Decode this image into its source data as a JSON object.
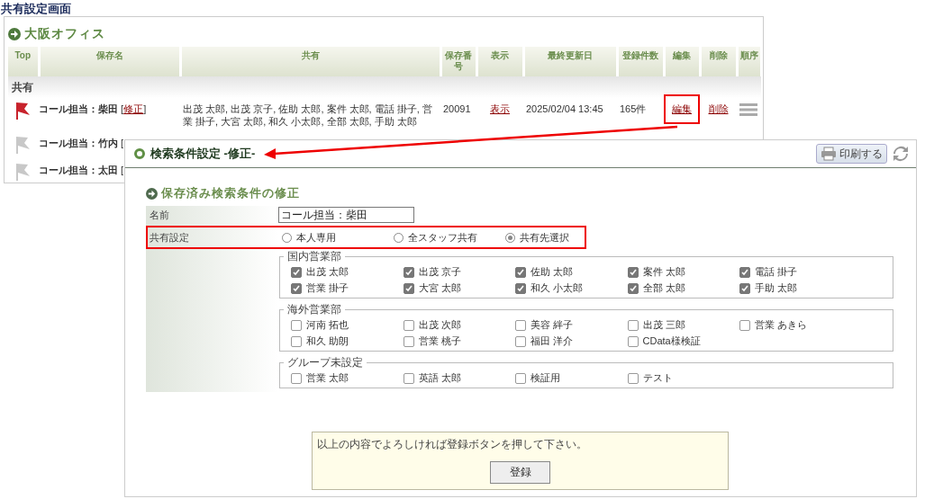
{
  "page_title": "共有設定画面",
  "office_panel": {
    "title": "大阪オフィス",
    "columns": [
      "Top",
      "保存名",
      "共有",
      "保存番号",
      "表示",
      "最終更新日",
      "登録件数",
      "編集",
      "削除",
      "順序"
    ],
    "group": "共有",
    "rows": [
      {
        "flag_active": true,
        "name": "コール担当：柴田",
        "bracket_open": "[",
        "edit_link": "修正",
        "bracket_close": "]",
        "shared_with": "出茂 太郎, 出茂 京子, 佐助 太郎, 案件 太郎, 電話 掛子, 営業 掛子, 大宮 太郎, 和久 小太郎, 全部 太郎, 手助 太郎",
        "number": "20091",
        "view_link": "表示",
        "updated": "2025/02/04 13:45",
        "count": "165件",
        "edit": "編集",
        "edit_highlighted": true,
        "delete": "削除"
      },
      {
        "flag_active": false,
        "name": "コール担当：竹内",
        "bracket_open": "["
      },
      {
        "flag_active": false,
        "name": "コール担当：太田",
        "bracket_open": "["
      }
    ]
  },
  "dialog": {
    "title": "検索条件設定 -修正-",
    "print_button": "印刷する",
    "section_title": "保存済み検索条件の修正",
    "name_label": "名前",
    "name_value": "コール担当：柴田",
    "share_label": "共有設定",
    "share_highlighted": true,
    "share_options": [
      {
        "label": "本人専用",
        "selected": false
      },
      {
        "label": "全スタッフ共有",
        "selected": false
      },
      {
        "label": "共有先選択",
        "selected": true
      }
    ],
    "groups": [
      {
        "title": "国内営業部",
        "members": [
          {
            "name": "出茂 太郎",
            "checked": true
          },
          {
            "name": "出茂 京子",
            "checked": true
          },
          {
            "name": "佐助 太郎",
            "checked": true
          },
          {
            "name": "案件 太郎",
            "checked": true
          },
          {
            "name": "電話 掛子",
            "checked": true
          },
          {
            "name": "営業 掛子",
            "checked": true
          },
          {
            "name": "大宮 太郎",
            "checked": true
          },
          {
            "name": "和久 小太郎",
            "checked": true
          },
          {
            "name": "全部 太郎",
            "checked": true
          },
          {
            "name": "手助 太郎",
            "checked": true
          }
        ]
      },
      {
        "title": "海外営業部",
        "members": [
          {
            "name": "河南 拓也",
            "checked": false
          },
          {
            "name": "出茂 次郎",
            "checked": false
          },
          {
            "name": "美容 絆子",
            "checked": false
          },
          {
            "name": "出茂 三郎",
            "checked": false
          },
          {
            "name": "営業 あきら",
            "checked": false
          },
          {
            "name": "和久 助朗",
            "checked": false
          },
          {
            "name": "営業 桃子",
            "checked": false
          },
          {
            "name": "福田 洋介",
            "checked": false
          },
          {
            "name": "CData様検証",
            "checked": false
          }
        ]
      },
      {
        "title": "グループ未設定",
        "members": [
          {
            "name": "営業 太郎",
            "checked": false
          },
          {
            "name": "英語 太郎",
            "checked": false
          },
          {
            "name": "検証用",
            "checked": false
          },
          {
            "name": "テスト",
            "checked": false
          }
        ]
      }
    ],
    "notice": "以上の内容でよろしければ登録ボタンを押して下さい。",
    "submit": "登録"
  }
}
